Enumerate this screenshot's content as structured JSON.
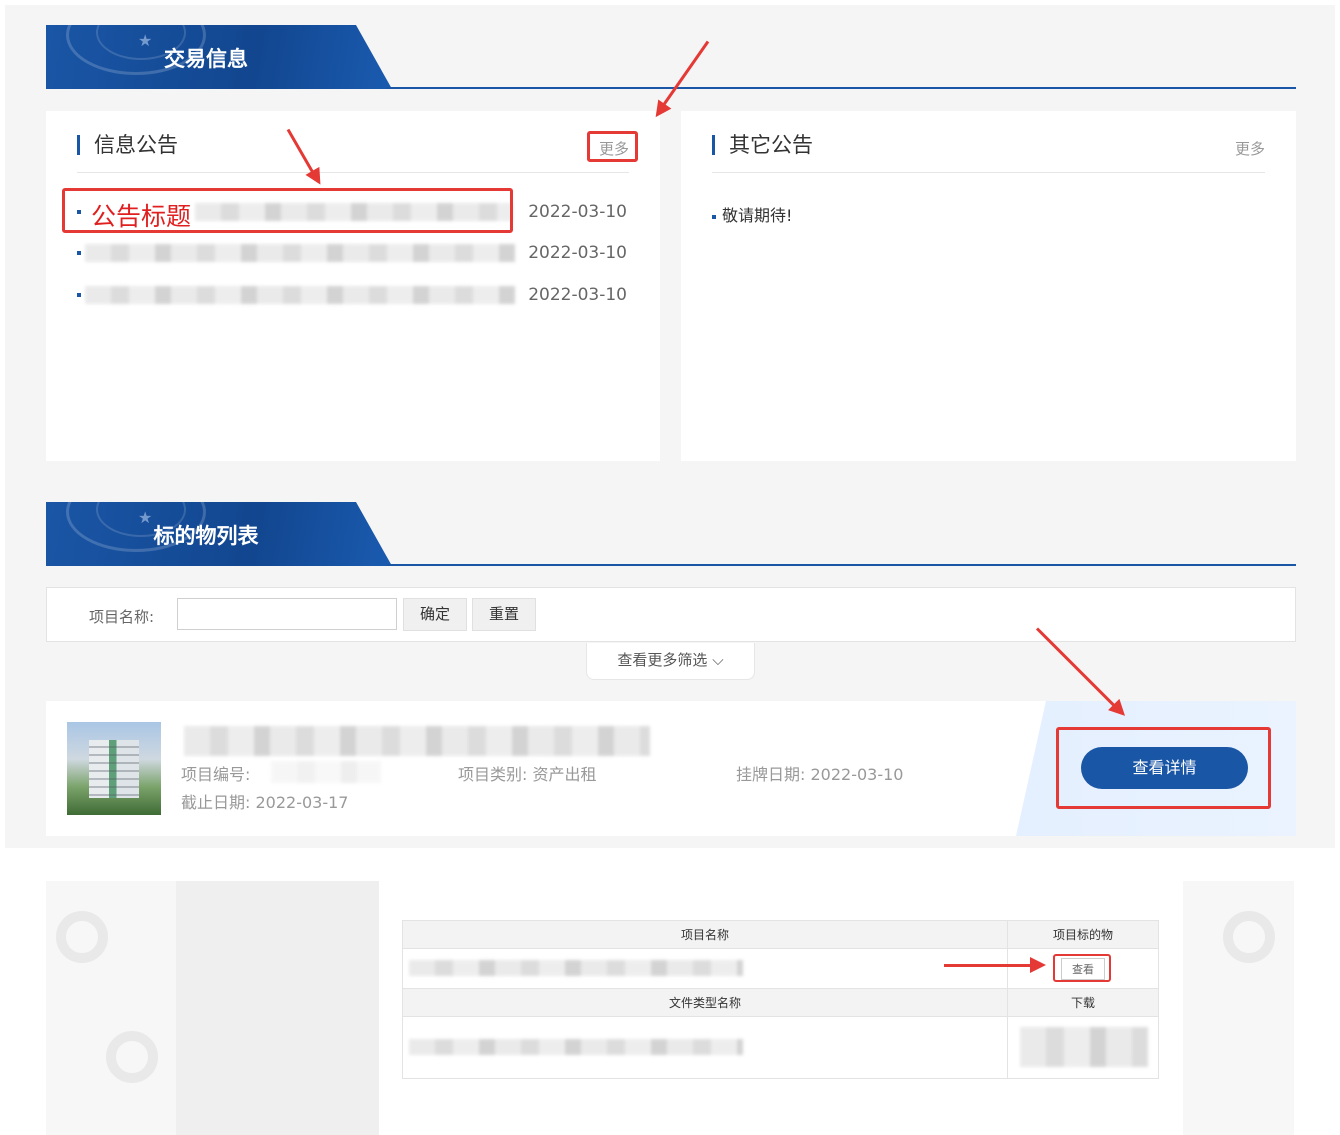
{
  "sections": {
    "trade_info_title": "交易信息",
    "item_list_title": "标的物列表"
  },
  "notice_panel": {
    "title": "信息公告",
    "more": "更多",
    "rows": [
      {
        "title": "公告标题",
        "date": "2022-03-10"
      },
      {
        "title": "",
        "date": "2022-03-10"
      },
      {
        "title": "",
        "date": "2022-03-10"
      }
    ]
  },
  "other_panel": {
    "title": "其它公告",
    "more": "更多",
    "text": "敬请期待!"
  },
  "filter": {
    "label": "项目名称:",
    "input_value": "",
    "confirm": "确定",
    "reset": "重置",
    "more_filter": "查看更多筛选 ⌵"
  },
  "item": {
    "code_label": "项目编号:",
    "category": "项目类别: 资产出租",
    "listed": "挂牌日期:  2022-03-10",
    "deadline": "截止日期:  2022-03-17",
    "detail_button": "查看详情"
  },
  "doc_table": {
    "col_name": "项目名称",
    "col_target": "项目标的物",
    "view": "查看",
    "col_filetype": "文件类型名称",
    "col_download": "下载"
  },
  "colors": {
    "brand_blue": "#1a56a6",
    "annotation_red": "#e53935"
  }
}
